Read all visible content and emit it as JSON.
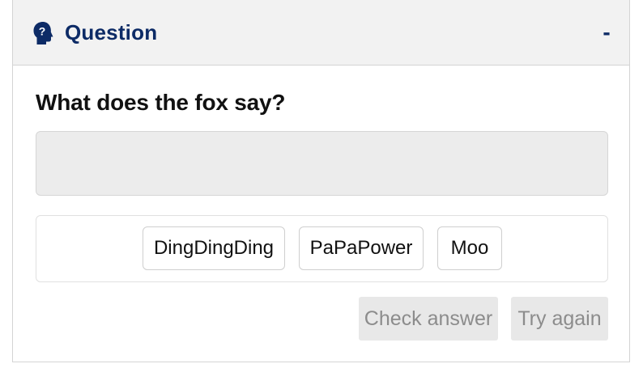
{
  "header": {
    "title": "Question",
    "collapse_label": "-",
    "icon": "head-question-icon",
    "title_color": "#0d2b66"
  },
  "question": {
    "text": "What does the fox say?"
  },
  "answer_area": {
    "value": ""
  },
  "word_bank": {
    "options": [
      "DingDingDing",
      "PaPaPower",
      "Moo"
    ]
  },
  "actions": {
    "check_label": "Check answer",
    "retry_label": "Try again"
  }
}
